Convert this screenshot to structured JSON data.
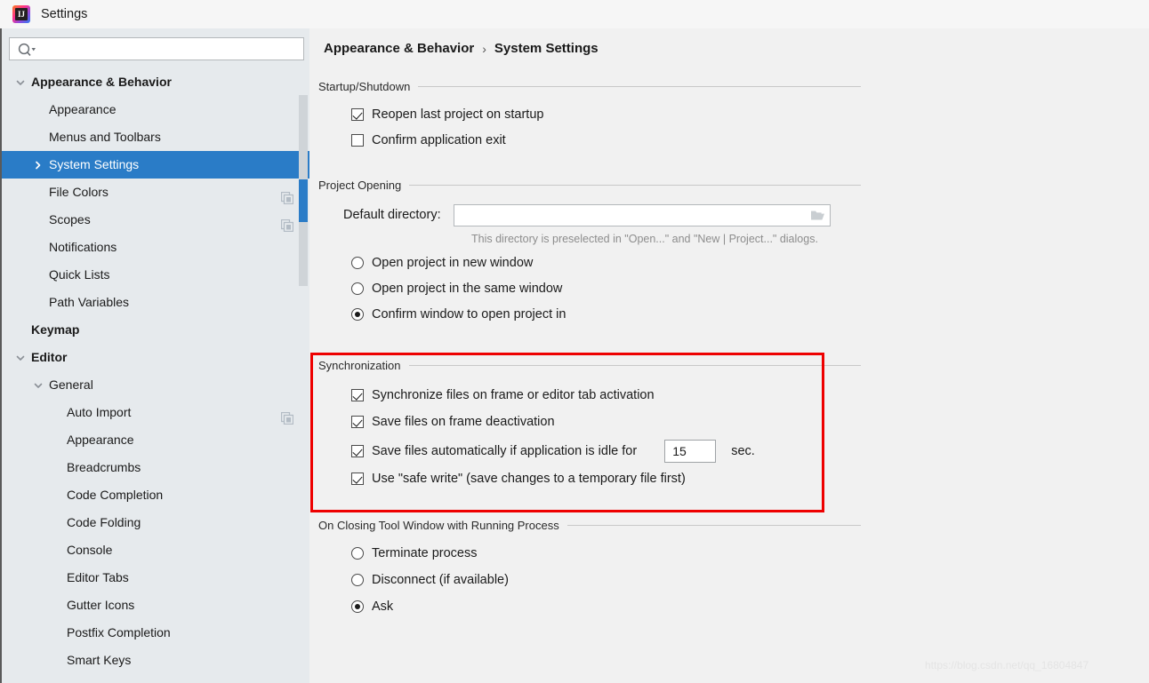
{
  "window": {
    "title": "Settings",
    "app_icon": "intellij-idea-icon"
  },
  "sidebar": {
    "search": {
      "value": "",
      "placeholder": "",
      "icon": "search-icon"
    },
    "items": [
      {
        "label": "Appearance & Behavior",
        "level": 0,
        "chevron": "chevron-down-icon",
        "bold": true,
        "selected": false,
        "copy_icon": false
      },
      {
        "label": "Appearance",
        "level": 1,
        "chevron": "none",
        "bold": false,
        "selected": false,
        "copy_icon": false
      },
      {
        "label": "Menus and Toolbars",
        "level": 1,
        "chevron": "none",
        "bold": false,
        "selected": false,
        "copy_icon": false
      },
      {
        "label": "System Settings",
        "level": 1,
        "chevron": "chevron-right-icon",
        "bold": false,
        "selected": true,
        "copy_icon": false
      },
      {
        "label": "File Colors",
        "level": 1,
        "chevron": "none",
        "bold": false,
        "selected": false,
        "copy_icon": true
      },
      {
        "label": "Scopes",
        "level": 1,
        "chevron": "none",
        "bold": false,
        "selected": false,
        "copy_icon": true
      },
      {
        "label": "Notifications",
        "level": 1,
        "chevron": "none",
        "bold": false,
        "selected": false,
        "copy_icon": false
      },
      {
        "label": "Quick Lists",
        "level": 1,
        "chevron": "none",
        "bold": false,
        "selected": false,
        "copy_icon": false
      },
      {
        "label": "Path Variables",
        "level": 1,
        "chevron": "none",
        "bold": false,
        "selected": false,
        "copy_icon": false
      },
      {
        "label": "Keymap",
        "level": 0,
        "chevron": "none",
        "bold": true,
        "selected": false,
        "copy_icon": false
      },
      {
        "label": "Editor",
        "level": 0,
        "chevron": "chevron-down-icon",
        "bold": true,
        "selected": false,
        "copy_icon": false
      },
      {
        "label": "General",
        "level": 1,
        "chevron": "chevron-down-icon",
        "bold": false,
        "selected": false,
        "copy_icon": false
      },
      {
        "label": "Auto Import",
        "level": 2,
        "chevron": "none",
        "bold": false,
        "selected": false,
        "copy_icon": true
      },
      {
        "label": "Appearance",
        "level": 2,
        "chevron": "none",
        "bold": false,
        "selected": false,
        "copy_icon": false
      },
      {
        "label": "Breadcrumbs",
        "level": 2,
        "chevron": "none",
        "bold": false,
        "selected": false,
        "copy_icon": false
      },
      {
        "label": "Code Completion",
        "level": 2,
        "chevron": "none",
        "bold": false,
        "selected": false,
        "copy_icon": false
      },
      {
        "label": "Code Folding",
        "level": 2,
        "chevron": "none",
        "bold": false,
        "selected": false,
        "copy_icon": false
      },
      {
        "label": "Console",
        "level": 2,
        "chevron": "none",
        "bold": false,
        "selected": false,
        "copy_icon": false
      },
      {
        "label": "Editor Tabs",
        "level": 2,
        "chevron": "none",
        "bold": false,
        "selected": false,
        "copy_icon": false
      },
      {
        "label": "Gutter Icons",
        "level": 2,
        "chevron": "none",
        "bold": false,
        "selected": false,
        "copy_icon": false
      },
      {
        "label": "Postfix Completion",
        "level": 2,
        "chevron": "none",
        "bold": false,
        "selected": false,
        "copy_icon": false
      },
      {
        "label": "Smart Keys",
        "level": 2,
        "chevron": "none",
        "bold": false,
        "selected": false,
        "copy_icon": false
      }
    ]
  },
  "breadcrumb": {
    "parent": "Appearance & Behavior",
    "separator": "›",
    "current": "System Settings"
  },
  "sections": {
    "startup": {
      "title": "Startup/Shutdown",
      "options": [
        {
          "label": "Reopen last project on startup",
          "checked": true
        },
        {
          "label": "Confirm application exit",
          "checked": false
        }
      ]
    },
    "project_opening": {
      "title": "Project Opening",
      "directory_label": "Default directory:",
      "directory_value": "",
      "directory_placeholder": "",
      "browse_icon": "folder-icon",
      "hint": "This directory is preselected in \"Open...\" and \"New | Project...\" dialogs.",
      "radios": [
        {
          "label": "Open project in new window",
          "selected": false
        },
        {
          "label": "Open project in the same window",
          "selected": false
        },
        {
          "label": "Confirm window to open project in",
          "selected": true
        }
      ]
    },
    "synchronization": {
      "title": "Synchronization",
      "highlight_color": "#ee0000",
      "options": [
        {
          "label": "Synchronize files on frame or editor tab activation",
          "checked": true
        },
        {
          "label": "Save files on frame deactivation",
          "checked": true
        },
        {
          "label": "Save files automatically if application is idle for",
          "checked": true
        },
        {
          "label": "Use \"safe write\" (save changes to a temporary file first)",
          "checked": true
        }
      ],
      "idle_value": "15",
      "idle_unit": "sec."
    },
    "on_closing": {
      "title": "On Closing Tool Window with Running Process",
      "radios": [
        {
          "label": "Terminate process",
          "selected": false
        },
        {
          "label": "Disconnect (if available)",
          "selected": false
        },
        {
          "label": "Ask",
          "selected": true
        }
      ]
    }
  },
  "watermark": "https://blog.csdn.net/qq_16804847",
  "colors": {
    "selection": "#2a7cc7",
    "sidebar_bg": "#e6eaed",
    "panel_bg": "#f1f1f1",
    "highlight": "#ee0000"
  }
}
